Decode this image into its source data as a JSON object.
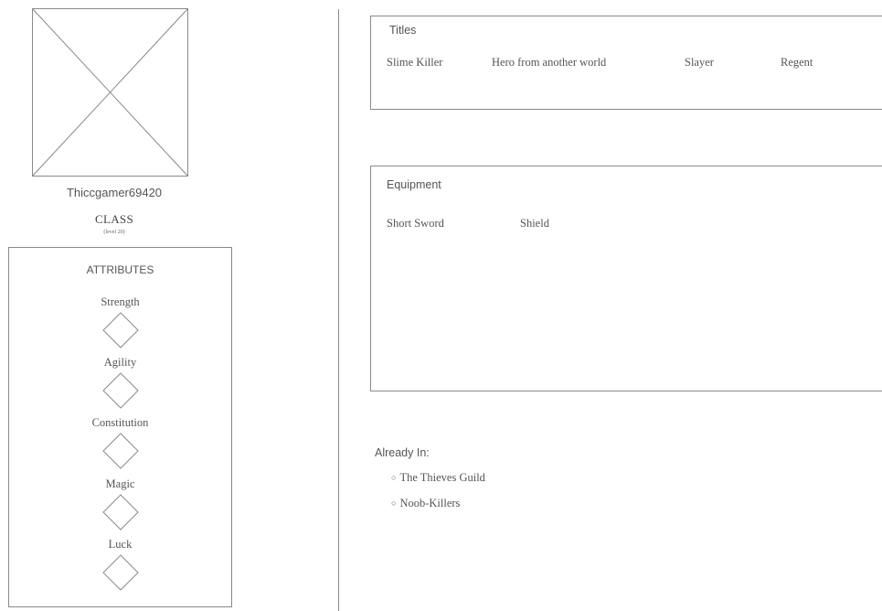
{
  "profile": {
    "username": "Thiccgamer69420",
    "class_name": "CLASS",
    "class_level": "(level 20)"
  },
  "attributes": {
    "heading": "ATTRIBUTES",
    "items": [
      {
        "label": "Strength",
        "icon": "diamond-icon"
      },
      {
        "label": "Agility",
        "icon": "diamond-icon"
      },
      {
        "label": "Constitution",
        "icon": "diamond-icon"
      },
      {
        "label": "Magic",
        "icon": "diamond-icon"
      },
      {
        "label": "Luck",
        "icon": "diamond-icon"
      }
    ]
  },
  "titles": {
    "heading": "Titles",
    "items": [
      "Slime Killer",
      "Hero from another world",
      "Slayer",
      "Regent"
    ]
  },
  "equipment": {
    "heading": "Equipment",
    "items": [
      "Short Sword",
      "Shield"
    ]
  },
  "guilds": {
    "heading": "Already In:",
    "items": [
      "The Thieves Guild",
      "Noob-Killers"
    ]
  },
  "colors": {
    "line": "#8a8a8a",
    "text": "#555555"
  }
}
